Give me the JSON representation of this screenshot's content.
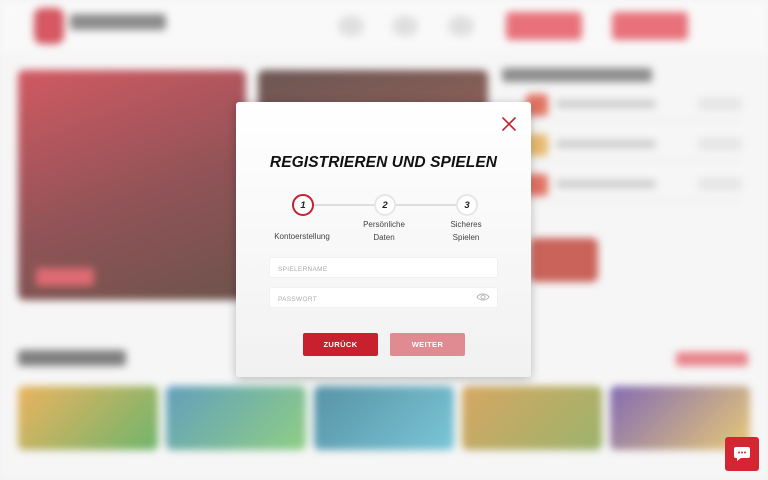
{
  "modal": {
    "title": "REGISTRIEREN UND SPIELEN",
    "steps": [
      {
        "number": "1",
        "label": "Kontoerstellung",
        "active": true
      },
      {
        "number": "2",
        "label_line1": "Persönliche",
        "label_line2": "Daten",
        "active": false
      },
      {
        "number": "3",
        "label_line1": "Sicheres",
        "label_line2": "Spielen",
        "active": false
      }
    ],
    "username": {
      "placeholder": "SPIELERNAME",
      "value": ""
    },
    "password": {
      "placeholder": "PASSWORT",
      "value": ""
    },
    "back_label": "ZURÜCK",
    "next_label": "WEITER"
  },
  "icons": {
    "close": "close-icon",
    "password_toggle": "eye-icon",
    "chat": "chat-icon"
  },
  "colors": {
    "brand_red": "#c8202e",
    "disabled_button": "#e08a91",
    "active_step_border": "#c8202e"
  }
}
